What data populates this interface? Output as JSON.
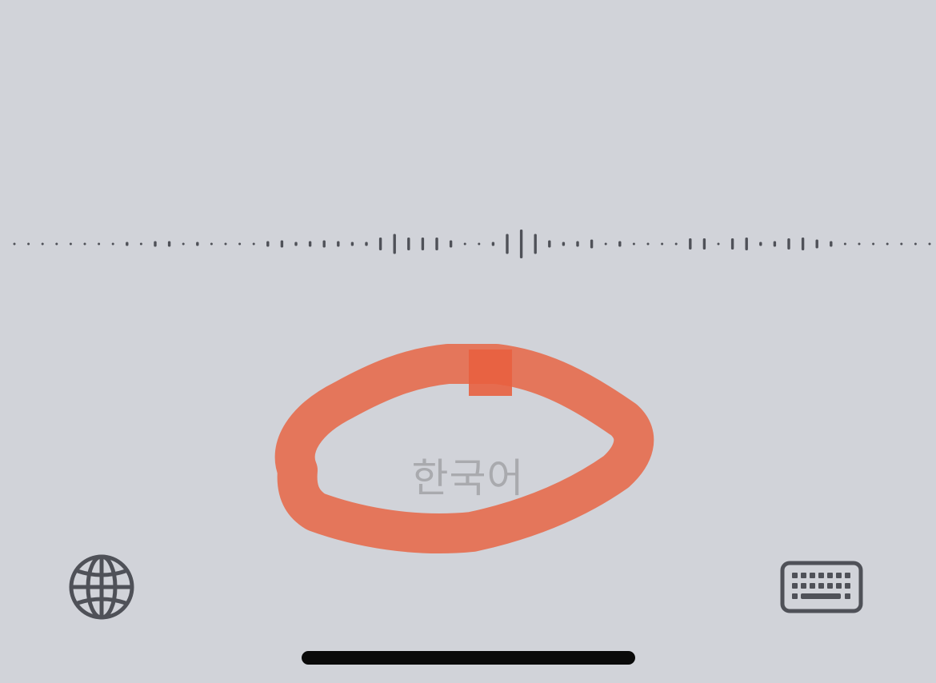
{
  "dictation": {
    "language_label": "한국어",
    "accent_color": "#e8613f",
    "waveform_color": "#4f5158",
    "background_color": "#d1d3d9"
  },
  "controls": {
    "globe_icon": "globe-icon",
    "keyboard_icon": "keyboard-icon"
  }
}
